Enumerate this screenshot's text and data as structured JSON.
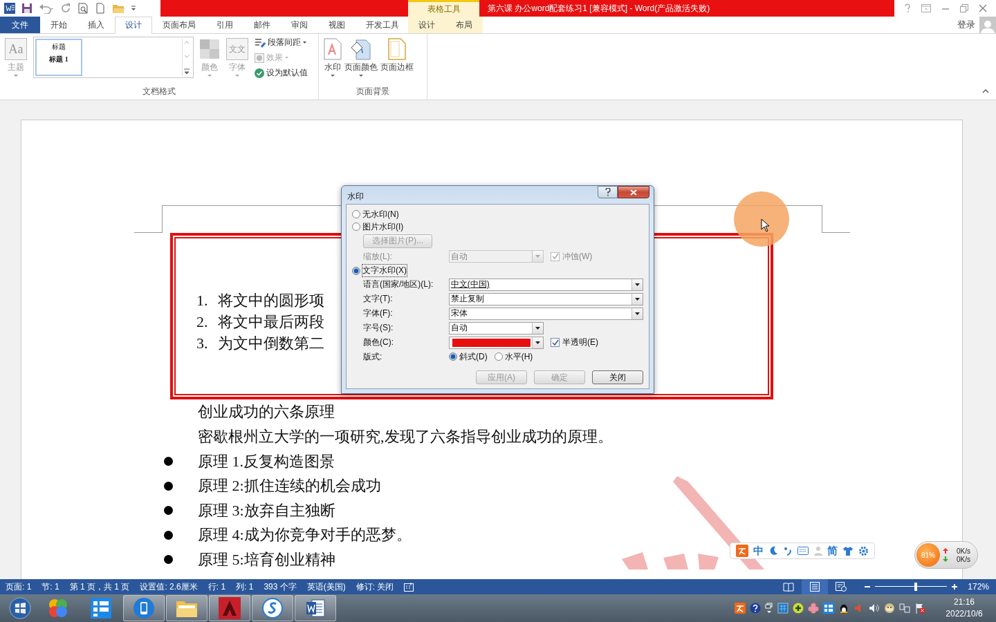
{
  "title_bar": {
    "title": "第六课 办公word配套练习1 [兼容模式] - Word(产品激活失败)",
    "context_group": "表格工具"
  },
  "tabs": [
    {
      "label": "文件",
      "kind": "file",
      "selected": false
    },
    {
      "label": "开始",
      "kind": "normal",
      "selected": false
    },
    {
      "label": "插入",
      "kind": "normal",
      "selected": false
    },
    {
      "label": "设计",
      "kind": "normal",
      "selected": true
    },
    {
      "label": "页面布局",
      "kind": "normal",
      "selected": false
    },
    {
      "label": "引用",
      "kind": "normal",
      "selected": false
    },
    {
      "label": "邮件",
      "kind": "normal",
      "selected": false
    },
    {
      "label": "审阅",
      "kind": "normal",
      "selected": false
    },
    {
      "label": "视图",
      "kind": "normal",
      "selected": false
    },
    {
      "label": "开发工具",
      "kind": "normal",
      "selected": false
    },
    {
      "label": "设计",
      "kind": "context",
      "selected": false
    },
    {
      "label": "布局",
      "kind": "context",
      "selected": false
    }
  ],
  "account": {
    "label": "登录"
  },
  "ribbon": {
    "document_format": {
      "label": "文档格式",
      "theme": {
        "glyph": "Aa",
        "label": "主题",
        "disabled": true
      },
      "gallery": {
        "preview_title": "标题",
        "preview_heading": "标题 1"
      },
      "colors": {
        "label": "颜色",
        "disabled": true
      },
      "fonts": {
        "glyph": "文文",
        "label": "字体",
        "disabled": true
      },
      "commands": [
        {
          "kind": "spacing",
          "label": "段落间距",
          "disabled": false
        },
        {
          "kind": "effects",
          "label": "效果",
          "disabled": true
        },
        {
          "kind": "default",
          "label": "设为默认值",
          "disabled": false
        }
      ]
    },
    "page_background": {
      "label": "页面背景",
      "commands": [
        {
          "kind": "watermark",
          "label": "水印"
        },
        {
          "kind": "page_color",
          "label": "页面颜色"
        },
        {
          "kind": "page_border",
          "label": "页面边框"
        }
      ]
    }
  },
  "document": {
    "numbered_list": [
      {
        "number": "1.",
        "text": "将文中的圆形项"
      },
      {
        "number": "2.",
        "text": "将文中最后两段"
      },
      {
        "number": "3.",
        "text": "为文中倒数第二"
      }
    ],
    "paragraphs": [
      "创业成功的六条原理",
      "密歇根州立大学的一项研究,发现了六条指导创业成功的原理。"
    ],
    "bullets": [
      "原理 1.反复构造图景",
      "原理 2:抓住连续的机会成功",
      "原理 3:放弃自主独断",
      "原理 4:成为你竞争对手的恶梦。",
      "原理 5:培育创业精神"
    ]
  },
  "dialog": {
    "title": "水印",
    "options": [
      {
        "label": "无水印(N)",
        "selected": false
      },
      {
        "label": "图片水印(I)",
        "selected": false
      },
      {
        "label": "文字水印(X)",
        "selected": true
      }
    ],
    "picture_button": {
      "label": "选择图片(P)...",
      "disabled": true
    },
    "scale": {
      "label": "缩放(L):",
      "value": "自动",
      "disabled": true
    },
    "washout": {
      "label": "冲蚀(W)",
      "checked": true,
      "disabled": true
    },
    "fields": [
      {
        "label": "语言(国家/地区)(L):",
        "value": "中文(中国)"
      },
      {
        "label": "文字(T):",
        "value": "禁止复制"
      },
      {
        "label": "字体(F):",
        "value": "宋体"
      }
    ],
    "size": {
      "label": "字号(S):",
      "value": "自动"
    },
    "color": {
      "label": "颜色(C):",
      "color": "#e80f0f"
    },
    "semi_transparent": {
      "label": "半透明(E)",
      "checked": true
    },
    "layout": {
      "label": "版式:",
      "options": [
        {
          "label": "斜式(D)",
          "selected": true
        },
        {
          "label": "水平(H)",
          "selected": false
        }
      ]
    },
    "buttons": [
      {
        "label": "应用(A)",
        "disabled": true
      },
      {
        "label": "确定",
        "disabled": true
      },
      {
        "label": "关闭",
        "disabled": false
      }
    ]
  },
  "status_bar": {
    "items": [
      "页面: 1",
      "节: 1",
      "第 1 页，共 1 页",
      "设置值: 2.6厘米",
      "行: 1",
      "列: 1",
      "393 个字",
      "英语(美国)",
      "修订: 关闭"
    ],
    "views": [
      {
        "kind": "read",
        "selected": false
      },
      {
        "kind": "print",
        "selected": true
      },
      {
        "kind": "web",
        "selected": false
      }
    ],
    "zoom": {
      "level": 0.57,
      "reading": "172%"
    }
  },
  "ime_bar": {
    "mode": "中",
    "script": "简"
  },
  "net_monitor": {
    "percent": "81%",
    "upload": "0K/s",
    "download": "0K/s"
  },
  "taskbar": {
    "apps": [
      {
        "kind": "colorful",
        "running": false
      },
      {
        "kind": "tiles",
        "running": false
      },
      {
        "kind": "phone",
        "running": true
      },
      {
        "kind": "folder",
        "running": true
      },
      {
        "kind": "cad",
        "running": true
      },
      {
        "kind": "browser",
        "running": true
      },
      {
        "kind": "word",
        "running": true
      }
    ],
    "clock": {
      "time": "21:16",
      "date": "2022/10/6"
    }
  }
}
